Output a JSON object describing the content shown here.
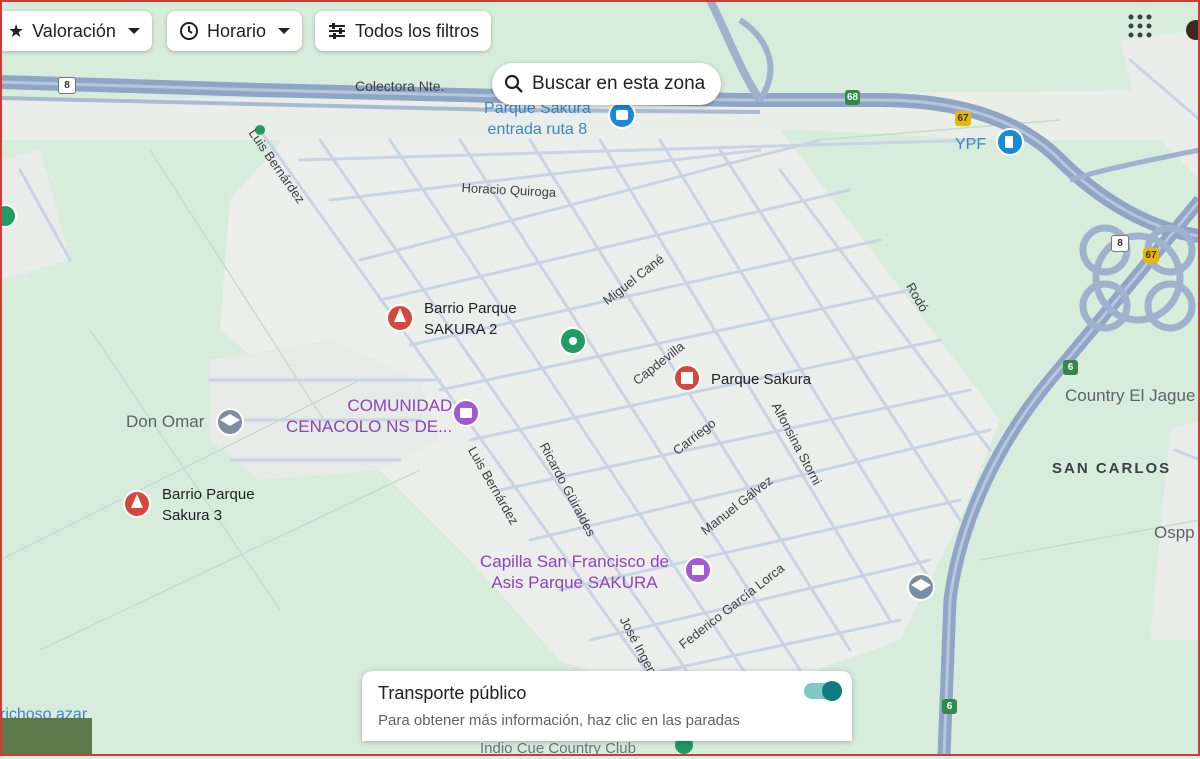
{
  "filters": {
    "rating_label": "Valoración",
    "hours_label": "Horario",
    "all_filters_label": "Todos los filtros"
  },
  "search_area_label": "Buscar en esta zona",
  "route_shields": [
    "8",
    "68",
    "67",
    "8",
    "67",
    "6",
    "6"
  ],
  "places": {
    "parque_sakura_ruta8": [
      "Parque Sakura",
      "entrada ruta 8"
    ],
    "ypf": "YPF",
    "barrio_sakura_2": [
      "Barrio Parque",
      "SAKURA 2"
    ],
    "parque_sakura": "Parque Sakura",
    "comunidad": [
      "COMUNIDAD",
      "CENACOLO NS DE..."
    ],
    "don_omar": "Don Omar",
    "barrio_sakura_3": [
      "Barrio Parque",
      "Sakura 3"
    ],
    "capilla": [
      "Capilla San Francisco de",
      "Asis Parque SAKURA"
    ],
    "country_el_jaguel": "Country El Jague",
    "san_carlos": "SAN CARLOS",
    "ospp": "Ospp",
    "caprichoso": "richoso azar",
    "indio_cue": "Indio Cue Country Club"
  },
  "streets": {
    "colectora": "Colectora Nte.",
    "horacio_quiroga": "Horacio Quiroga",
    "luis_bernardez_top": "Luis Bernárdez",
    "miguel_cane": "Miguel Cané",
    "rodo": "Rodó",
    "capdevilla": "Capdevilla",
    "carriego": "Carriego",
    "alfonsina_storni": "Alfonsina Storni",
    "luis_bernardez": "Luis Bernárdez",
    "ricardo_guiraldes": "Ricardo Güiraldes",
    "manuel_galvez": "Manuel Gálvez",
    "federico_garcia_lorca": "Federico García Lorca",
    "jose_ingenieros": "José Ingen"
  },
  "transit": {
    "title": "Transporte público",
    "subtitle": "Para obtener más información, haz clic en las paradas",
    "enabled": true
  },
  "colors": {
    "park_green": "#cfe9d4",
    "urban": "#eef0ee",
    "highway": "#8fa5c6",
    "poi_red": "#d5473c",
    "poi_purple": "#a35ad1",
    "poi_gray": "#7b8ea3",
    "poi_blue": "#1b8ad6",
    "poi_green": "#1e9c63"
  }
}
